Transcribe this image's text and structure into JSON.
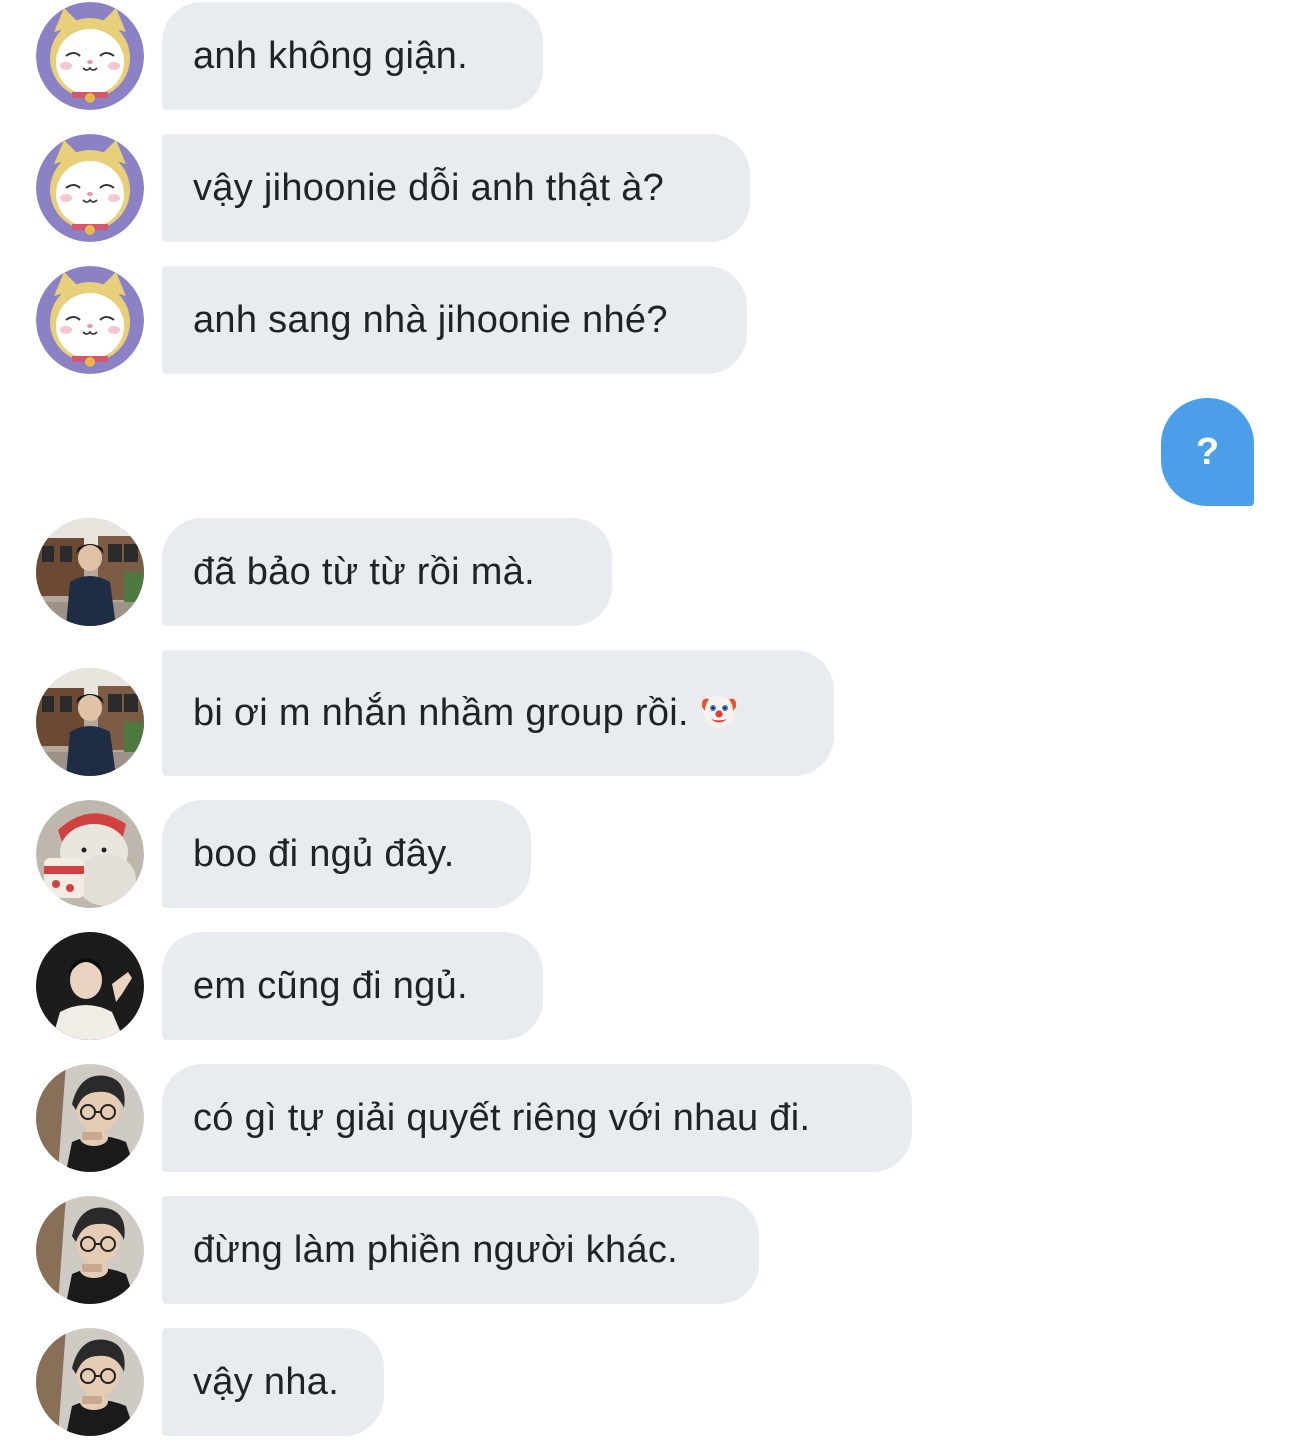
{
  "conversation": {
    "messages": [
      {
        "sender_avatar": "cat-cartoon-avatar",
        "text": "anh không giận."
      },
      {
        "sender_avatar": "cat-cartoon-avatar",
        "text": "vậy jihoonie dỗi anh thật à?"
      },
      {
        "sender_avatar": "cat-cartoon-avatar",
        "text": "anh sang nhà jihoonie nhé?"
      },
      {
        "sender_avatar": "me",
        "text": "?"
      },
      {
        "sender_avatar": "street-photo-avatar",
        "text": "đã bảo từ từ rồi mà."
      },
      {
        "sender_avatar": "street-photo-avatar",
        "text": "bi ơi m nhắn nhầm group rồi.",
        "emoji": "clown-face-icon"
      },
      {
        "sender_avatar": "polar-bear-avatar",
        "text": "boo đi ngủ đây."
      },
      {
        "sender_avatar": "dark-portrait-avatar",
        "text": "em cũng đi ngủ."
      },
      {
        "sender_avatar": "glasses-boy-avatar",
        "text": "có gì tự giải quyết riêng với nhau đi."
      },
      {
        "sender_avatar": "glasses-boy-avatar",
        "text": "đừng làm phiền người khác."
      },
      {
        "sender_avatar": "glasses-boy-avatar",
        "text": "vậy nha."
      }
    ]
  },
  "colors": {
    "incoming_bubble": "#e8ebef",
    "outgoing_bubble": "#4a9fe8",
    "text": "#1f2328",
    "background": "#ffffff"
  }
}
